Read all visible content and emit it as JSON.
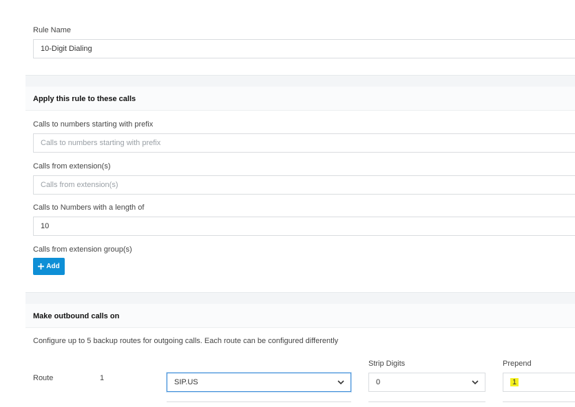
{
  "rule_name": {
    "label": "Rule Name",
    "value": "10-Digit Dialing"
  },
  "apply_section": {
    "title": "Apply this rule to these calls",
    "prefix": {
      "label": "Calls to numbers starting with prefix",
      "placeholder": "Calls to numbers starting with prefix",
      "value": ""
    },
    "from_extensions": {
      "label": "Calls from extension(s)",
      "placeholder": "Calls from extension(s)",
      "value": ""
    },
    "length": {
      "label": "Calls to Numbers with a length of",
      "value": "10"
    },
    "ext_groups": {
      "label": "Calls from extension group(s)",
      "add_label": "Add"
    }
  },
  "outbound_section": {
    "title": "Make outbound calls on",
    "description": "Configure up to 5 backup routes for outgoing calls. Each route can be configured differently",
    "columns": {
      "strip_digits": "Strip Digits",
      "prepend": "Prepend"
    },
    "route": {
      "label": "Route",
      "number": "1",
      "trunk": "SIP.US",
      "strip_digits": "0",
      "prepend": "1"
    }
  },
  "colors": {
    "accent": "#0e8fd6",
    "focus_border": "#3a8bd8",
    "highlight": "#f4f01e"
  }
}
